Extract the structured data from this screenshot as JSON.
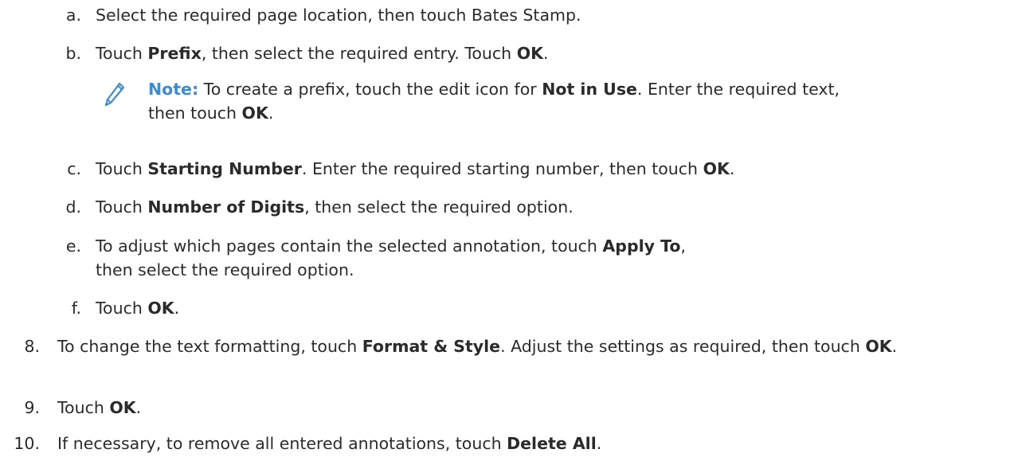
{
  "steps": {
    "a": {
      "marker": "a.",
      "text": "Select the required page location, then touch Bates Stamp."
    },
    "b": {
      "marker": "b.",
      "t1": "Touch ",
      "b1": "Prefix",
      "t2": ", then select the required entry. Touch ",
      "b2": "OK",
      "t3": "."
    },
    "note": {
      "icon": "pencil-icon",
      "label": "Note:",
      "t1": " To create a prefix, touch the edit icon for ",
      "b1": "Not in Use",
      "t2": ". Enter the required text, then touch ",
      "b2": "OK",
      "t3": "."
    },
    "c": {
      "marker": "c.",
      "t1": "Touch ",
      "b1": "Starting Number",
      "t2": ". Enter the required starting number, then touch ",
      "b2": "OK",
      "t3": "."
    },
    "d": {
      "marker": "d.",
      "t1": "Touch ",
      "b1": "Number of Digits",
      "t2": ", then select the required option."
    },
    "e": {
      "marker": "e.",
      "t1": "To adjust which pages contain the selected annotation, touch ",
      "b1": "Apply To",
      "t2": ", then select the required option."
    },
    "f": {
      "marker": "f.",
      "t1": "Touch ",
      "b1": "OK",
      "t2": "."
    },
    "s8": {
      "marker": "8.",
      "t1": "To change the text formatting, touch ",
      "b1": "Format & Style",
      "t2": ". Adjust the settings as required, then touch ",
      "b2": "OK",
      "t3": "."
    },
    "s9": {
      "marker": "9.",
      "t1": "Touch ",
      "b1": "OK",
      "t2": "."
    },
    "s10": {
      "marker": "10.",
      "t1": "If necessary, to remove all entered annotations, touch ",
      "b1": "Delete All",
      "t2": "."
    }
  },
  "colors": {
    "text": "#2b2b2b",
    "note_accent": "#3d8bd6"
  }
}
